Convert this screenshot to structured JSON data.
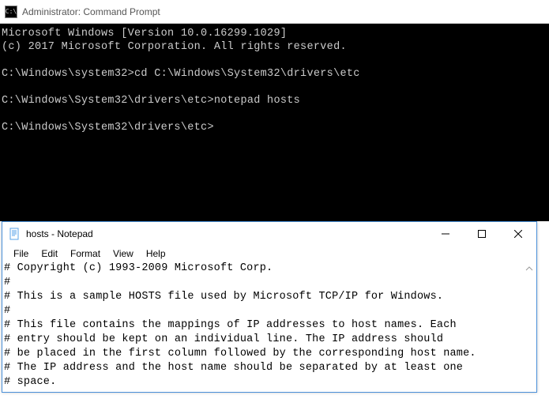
{
  "cmd": {
    "title": "Administrator: Command Prompt",
    "icon_label": "C:\\",
    "lines": {
      "l0": "Microsoft Windows [Version 10.0.16299.1029]",
      "l1": "(c) 2017 Microsoft Corporation. All rights reserved.",
      "l2": "",
      "l3": "C:\\Windows\\system32>cd C:\\Windows\\System32\\drivers\\etc",
      "l4": "",
      "l5": "C:\\Windows\\System32\\drivers\\etc>notepad hosts",
      "l6": "",
      "l7": "C:\\Windows\\System32\\drivers\\etc>"
    }
  },
  "notepad": {
    "title": "hosts - Notepad",
    "menu": {
      "file": "File",
      "edit": "Edit",
      "format": "Format",
      "view": "View",
      "help": "Help"
    },
    "content": {
      "l0": "# Copyright (c) 1993-2009 Microsoft Corp.",
      "l1": "#",
      "l2": "# This is a sample HOSTS file used by Microsoft TCP/IP for Windows.",
      "l3": "#",
      "l4": "# This file contains the mappings of IP addresses to host names. Each",
      "l5": "# entry should be kept on an individual line. The IP address should",
      "l6": "# be placed in the first column followed by the corresponding host name.",
      "l7": "# The IP address and the host name should be separated by at least one",
      "l8": "# space."
    }
  }
}
